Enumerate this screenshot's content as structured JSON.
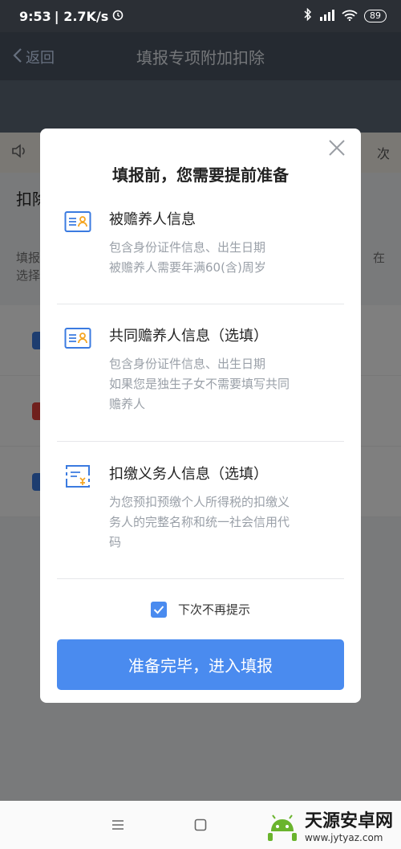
{
  "status_bar": {
    "time": "9:53",
    "speed": "| 2.7K/s",
    "battery": "89"
  },
  "underlay": {
    "back_label": "返回",
    "page_title": "填报专项附加扣除",
    "notice_tail": "次",
    "section_title": "扣除",
    "text_line1": "填报",
    "text_line1_tail": "在",
    "text_line2": "选择"
  },
  "modal": {
    "title": "填报前，您需要提前准备",
    "items": [
      {
        "title": "被赡养人信息",
        "desc_lines": [
          "包含身份证件信息、出生日期",
          "被赡养人需要年满60(含)周岁"
        ]
      },
      {
        "title": "共同赡养人信息（选填）",
        "desc_lines": [
          "包含身份证件信息、出生日期",
          "如果您是独生子女不需要填写共同",
          "赡养人"
        ]
      },
      {
        "title": "扣缴义务人信息（选填）",
        "desc_lines": [
          "为您预扣预缴个人所得税的扣缴义",
          "务人的完整名称和统一社会信用代",
          "码"
        ]
      }
    ],
    "checkbox_label": "下次不再提示",
    "checkbox_checked": true,
    "confirm_label": "准备完毕，进入填报"
  },
  "watermark": {
    "name": "天源安卓网",
    "url": "www.jytyaz.com"
  },
  "colors": {
    "accent": "#4a8bef",
    "item_icon": "#3b7be0",
    "item_icon_secondary": "#f5a623"
  },
  "icons": {
    "close": "close-icon",
    "id_card": "id-card-icon",
    "invoice": "invoice-icon",
    "check": "check-icon",
    "menu": "menu-icon",
    "home": "home-square-icon",
    "back": "back-chevron-icon",
    "volume": "volume-icon"
  }
}
